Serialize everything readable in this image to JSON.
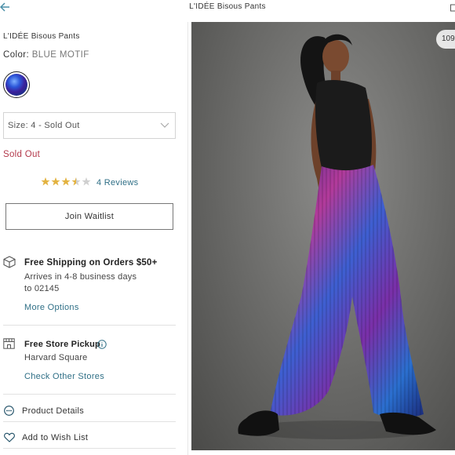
{
  "header": {
    "title": "L'IDÉE Bisous Pants",
    "back_icon": "arrow-left-icon",
    "right_icon": "bag-icon"
  },
  "product": {
    "name": "L'IDÉE Bisous Pants",
    "color_label": "Color:",
    "color_value": "BLUE MOTIF",
    "swatch_colors": [
      "#2b55d8",
      "#3b1f99",
      "#7fb0ff"
    ]
  },
  "size_selector": {
    "label": "Size: 4 - Sold Out",
    "icon": "chevron-down-icon"
  },
  "status": {
    "text": "Sold Out",
    "color": "#b3394b"
  },
  "rating": {
    "value": 3.5,
    "max": 5,
    "reviews_text": "4 Reviews"
  },
  "waitlist": {
    "label": "Join Waitlist"
  },
  "shipping": {
    "icon": "box-icon",
    "title": "Free Shipping on Orders $50+",
    "line1": "Arrives in 4-8 business days",
    "line2": "to 02145",
    "link": "More Options"
  },
  "pickup": {
    "icon": "store-icon",
    "title": "Free Store Pickup",
    "info_icon": "info-icon",
    "store": "Harvard Square",
    "link": "Check Other Stores"
  },
  "accordion": [
    {
      "icon": "more-dots-icon",
      "label": "Product Details"
    },
    {
      "icon": "heart-icon",
      "label": "Add to Wish List"
    }
  ],
  "gallery": {
    "counter": "109",
    "image": "model-wearing-pleated-pants-photo"
  },
  "colors": {
    "link": "#2f6f86",
    "sold_out": "#b3394b",
    "star_filled": "#e3b341",
    "star_empty": "#cfcfcf"
  }
}
